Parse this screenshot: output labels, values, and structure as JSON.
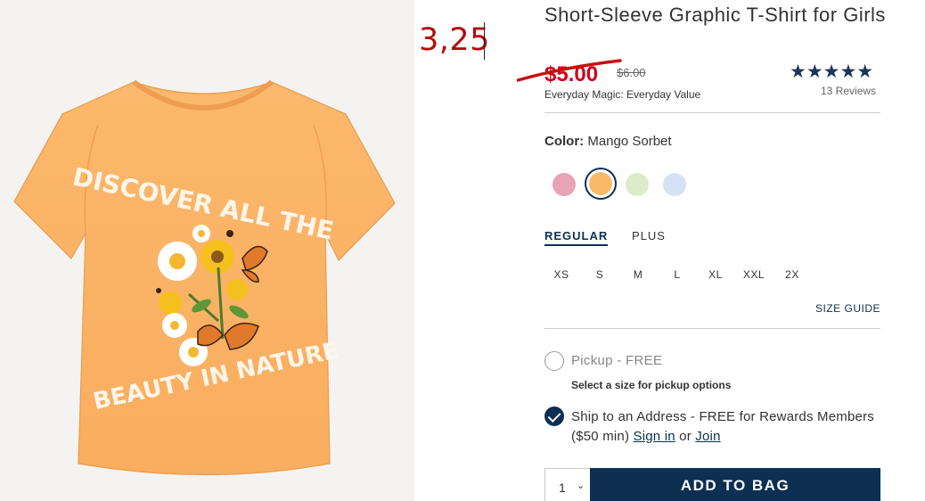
{
  "annotation": {
    "handwritten_price": "3,25"
  },
  "product": {
    "title": "Short-Sleeve Graphic T-Shirt for Girls",
    "sale_price": "$5.00",
    "original_price": "$6.00",
    "promo_text": "Everyday Magic: Everyday Value",
    "rating_stars": "★★★★★",
    "rating_value": 5,
    "reviews_label": "13 Reviews",
    "image_text_top": "DISCOVER ALL THE",
    "image_text_bottom": "BEAUTY IN NATURE"
  },
  "color": {
    "label": "Color:",
    "selected": "Mango Sorbet",
    "swatches": [
      {
        "name": "pink",
        "hex": "#e8a3b6"
      },
      {
        "name": "mango-sorbet",
        "hex": "#f8b96b"
      },
      {
        "name": "mint",
        "hex": "#dcebc8"
      },
      {
        "name": "light-blue",
        "hex": "#d5e2f5"
      }
    ]
  },
  "fit": {
    "tabs": [
      "REGULAR",
      "PLUS"
    ],
    "active": "REGULAR"
  },
  "sizes": [
    "XS",
    "S",
    "M",
    "L",
    "XL",
    "XXL",
    "2X"
  ],
  "size_guide": "SIZE GUIDE",
  "fulfillment": {
    "pickup_label": "Pickup - FREE",
    "pickup_note": "Select a size for pickup options",
    "ship_text": "Ship to an Address - FREE for Rewards Members ($50 min)",
    "sign_in": "Sign in",
    "or": "or",
    "join": "Join"
  },
  "purchase": {
    "quantity": "1",
    "add_to_bag": "ADD TO BAG"
  },
  "colors": {
    "navy": "#0c2f52",
    "sale_red": "#d0021b",
    "annotation_red": "#b10d0d",
    "shirt": "#fbb66a"
  }
}
